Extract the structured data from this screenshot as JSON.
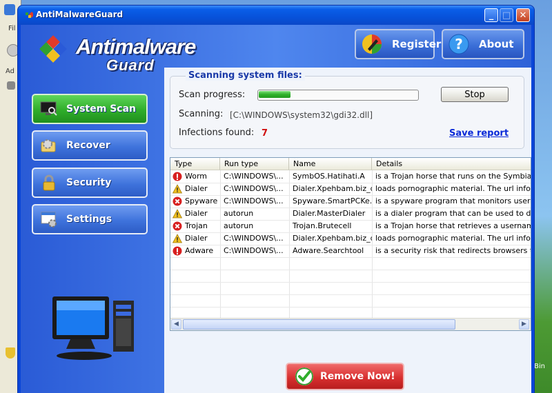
{
  "window": {
    "title": "AntiMalwareGuard"
  },
  "logo": {
    "line1": "Antimalware",
    "line2": "Guard"
  },
  "top_buttons": {
    "register": "Register",
    "about": "About"
  },
  "nav": [
    {
      "label": "System Scan",
      "icon": "monitor-magnifier-icon",
      "active": true
    },
    {
      "label": "Recover",
      "icon": "gear-folder-icon",
      "active": false
    },
    {
      "label": "Security",
      "icon": "lock-icon",
      "active": false
    },
    {
      "label": "Settings",
      "icon": "settings-window-icon",
      "active": false
    }
  ],
  "scan": {
    "legend": "Scanning system files:",
    "progress_label": "Scan progress:",
    "progress_fraction": 0.2,
    "stop_label": "Stop",
    "scanning_label": "Scanning:",
    "scanning_path": "[C:\\WINDOWS\\system32\\gdi32.dll]",
    "infections_label": "Infections found:",
    "infections_count": "7",
    "save_report": "Save report"
  },
  "table": {
    "columns": [
      "Type",
      "Run type",
      "Name",
      "Details"
    ],
    "rows": [
      {
        "severity": "alert",
        "type": "Worm",
        "run_type": "C:\\WINDOWS\\...",
        "name": "SymbOS.Hatihati.A",
        "details": "is a Trojan horse that runs on the Symbian OS."
      },
      {
        "severity": "warning",
        "type": "Dialer",
        "run_type": "C:\\WINDOWS\\...",
        "name": "Dialer.Xpehbam.biz_d",
        "details": "loads pornographic material. The url information"
      },
      {
        "severity": "critical",
        "type": "Spyware",
        "run_type": "C:\\WINDOWS\\...",
        "name": "Spyware.SmartPCKe...",
        "details": "is a spyware program that monitors user activity"
      },
      {
        "severity": "warning",
        "type": "Dialer",
        "run_type": "autorun",
        "name": "Dialer.MasterDialer",
        "details": "is a dialer program that can be used to dial high"
      },
      {
        "severity": "critical",
        "type": "Trojan",
        "run_type": "autorun",
        "name": "Trojan.Brutecell",
        "details": "is a Trojan horse that retrieves a username and"
      },
      {
        "severity": "warning",
        "type": "Dialer",
        "run_type": "C:\\WINDOWS\\...",
        "name": "Dialer.Xpehbam.biz_d",
        "details": "loads pornographic material. The url information"
      },
      {
        "severity": "alert",
        "type": "Adware",
        "run_type": "C:\\WINDOWS\\...",
        "name": "Adware.Searchtool",
        "details": "is a security risk that redirects browsers to certa"
      }
    ]
  },
  "remove_button": "Remove Now!",
  "desktop": {
    "recycle_bin_fragment": "Bin"
  },
  "background_window": {
    "fragments": [
      "Fil",
      "Ad"
    ]
  },
  "colors": {
    "window_blue": "#0a46d8",
    "nav_active_green": "#2fad2a",
    "remove_red": "#d83030",
    "infections_red": "#d01010",
    "link_blue": "#0a2ad8"
  }
}
